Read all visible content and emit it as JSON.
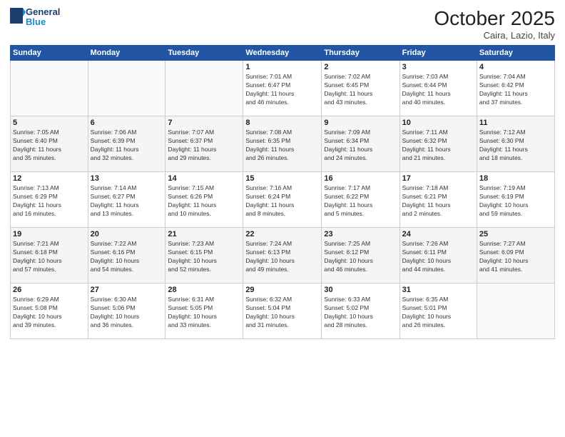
{
  "header": {
    "logo_general": "General",
    "logo_blue": "Blue",
    "month": "October 2025",
    "location": "Caira, Lazio, Italy"
  },
  "days_of_week": [
    "Sunday",
    "Monday",
    "Tuesday",
    "Wednesday",
    "Thursday",
    "Friday",
    "Saturday"
  ],
  "weeks": [
    [
      {
        "day": "",
        "info": ""
      },
      {
        "day": "",
        "info": ""
      },
      {
        "day": "",
        "info": ""
      },
      {
        "day": "1",
        "info": "Sunrise: 7:01 AM\nSunset: 6:47 PM\nDaylight: 11 hours\nand 46 minutes."
      },
      {
        "day": "2",
        "info": "Sunrise: 7:02 AM\nSunset: 6:45 PM\nDaylight: 11 hours\nand 43 minutes."
      },
      {
        "day": "3",
        "info": "Sunrise: 7:03 AM\nSunset: 6:44 PM\nDaylight: 11 hours\nand 40 minutes."
      },
      {
        "day": "4",
        "info": "Sunrise: 7:04 AM\nSunset: 6:42 PM\nDaylight: 11 hours\nand 37 minutes."
      }
    ],
    [
      {
        "day": "5",
        "info": "Sunrise: 7:05 AM\nSunset: 6:40 PM\nDaylight: 11 hours\nand 35 minutes."
      },
      {
        "day": "6",
        "info": "Sunrise: 7:06 AM\nSunset: 6:39 PM\nDaylight: 11 hours\nand 32 minutes."
      },
      {
        "day": "7",
        "info": "Sunrise: 7:07 AM\nSunset: 6:37 PM\nDaylight: 11 hours\nand 29 minutes."
      },
      {
        "day": "8",
        "info": "Sunrise: 7:08 AM\nSunset: 6:35 PM\nDaylight: 11 hours\nand 26 minutes."
      },
      {
        "day": "9",
        "info": "Sunrise: 7:09 AM\nSunset: 6:34 PM\nDaylight: 11 hours\nand 24 minutes."
      },
      {
        "day": "10",
        "info": "Sunrise: 7:11 AM\nSunset: 6:32 PM\nDaylight: 11 hours\nand 21 minutes."
      },
      {
        "day": "11",
        "info": "Sunrise: 7:12 AM\nSunset: 6:30 PM\nDaylight: 11 hours\nand 18 minutes."
      }
    ],
    [
      {
        "day": "12",
        "info": "Sunrise: 7:13 AM\nSunset: 6:29 PM\nDaylight: 11 hours\nand 16 minutes."
      },
      {
        "day": "13",
        "info": "Sunrise: 7:14 AM\nSunset: 6:27 PM\nDaylight: 11 hours\nand 13 minutes."
      },
      {
        "day": "14",
        "info": "Sunrise: 7:15 AM\nSunset: 6:26 PM\nDaylight: 11 hours\nand 10 minutes."
      },
      {
        "day": "15",
        "info": "Sunrise: 7:16 AM\nSunset: 6:24 PM\nDaylight: 11 hours\nand 8 minutes."
      },
      {
        "day": "16",
        "info": "Sunrise: 7:17 AM\nSunset: 6:22 PM\nDaylight: 11 hours\nand 5 minutes."
      },
      {
        "day": "17",
        "info": "Sunrise: 7:18 AM\nSunset: 6:21 PM\nDaylight: 11 hours\nand 2 minutes."
      },
      {
        "day": "18",
        "info": "Sunrise: 7:19 AM\nSunset: 6:19 PM\nDaylight: 10 hours\nand 59 minutes."
      }
    ],
    [
      {
        "day": "19",
        "info": "Sunrise: 7:21 AM\nSunset: 6:18 PM\nDaylight: 10 hours\nand 57 minutes."
      },
      {
        "day": "20",
        "info": "Sunrise: 7:22 AM\nSunset: 6:16 PM\nDaylight: 10 hours\nand 54 minutes."
      },
      {
        "day": "21",
        "info": "Sunrise: 7:23 AM\nSunset: 6:15 PM\nDaylight: 10 hours\nand 52 minutes."
      },
      {
        "day": "22",
        "info": "Sunrise: 7:24 AM\nSunset: 6:13 PM\nDaylight: 10 hours\nand 49 minutes."
      },
      {
        "day": "23",
        "info": "Sunrise: 7:25 AM\nSunset: 6:12 PM\nDaylight: 10 hours\nand 46 minutes."
      },
      {
        "day": "24",
        "info": "Sunrise: 7:26 AM\nSunset: 6:11 PM\nDaylight: 10 hours\nand 44 minutes."
      },
      {
        "day": "25",
        "info": "Sunrise: 7:27 AM\nSunset: 6:09 PM\nDaylight: 10 hours\nand 41 minutes."
      }
    ],
    [
      {
        "day": "26",
        "info": "Sunrise: 6:29 AM\nSunset: 5:08 PM\nDaylight: 10 hours\nand 39 minutes."
      },
      {
        "day": "27",
        "info": "Sunrise: 6:30 AM\nSunset: 5:06 PM\nDaylight: 10 hours\nand 36 minutes."
      },
      {
        "day": "28",
        "info": "Sunrise: 6:31 AM\nSunset: 5:05 PM\nDaylight: 10 hours\nand 33 minutes."
      },
      {
        "day": "29",
        "info": "Sunrise: 6:32 AM\nSunset: 5:04 PM\nDaylight: 10 hours\nand 31 minutes."
      },
      {
        "day": "30",
        "info": "Sunrise: 6:33 AM\nSunset: 5:02 PM\nDaylight: 10 hours\nand 28 minutes."
      },
      {
        "day": "31",
        "info": "Sunrise: 6:35 AM\nSunset: 5:01 PM\nDaylight: 10 hours\nand 26 minutes."
      },
      {
        "day": "",
        "info": ""
      }
    ]
  ]
}
